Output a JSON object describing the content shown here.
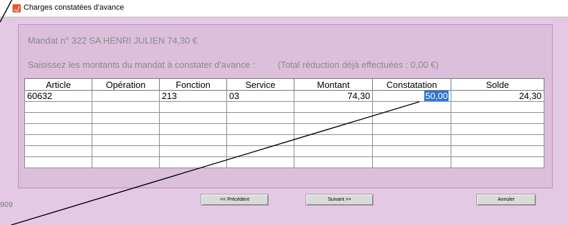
{
  "window": {
    "title": "Charges constatées d'avance"
  },
  "mandat": {
    "header": "Mandat n° 322   SA HENRI JULIEN  74,30 €",
    "instruction": "Saisissez les montants du mandat à constater d'avance :",
    "total_note": "(Total réduction déjà effectuées : 0,00 €)"
  },
  "table": {
    "columns": [
      "Article",
      "Opération",
      "Fonction",
      "Service",
      "Montant",
      "Constatation",
      "Solde"
    ],
    "rows": [
      {
        "article": "60632",
        "operation": "",
        "fonction": "213",
        "service": "03",
        "montant": "74,30",
        "constatation": "50,00",
        "solde": "24,30"
      }
    ]
  },
  "buttons": {
    "precedent": "<< Précédent",
    "suivant": "Suivant >>",
    "annuler": "Annuler"
  },
  "status": {
    "code": "909"
  },
  "colors": {
    "window_bg": "#e4c9e4",
    "selection": "#2f74d0"
  }
}
